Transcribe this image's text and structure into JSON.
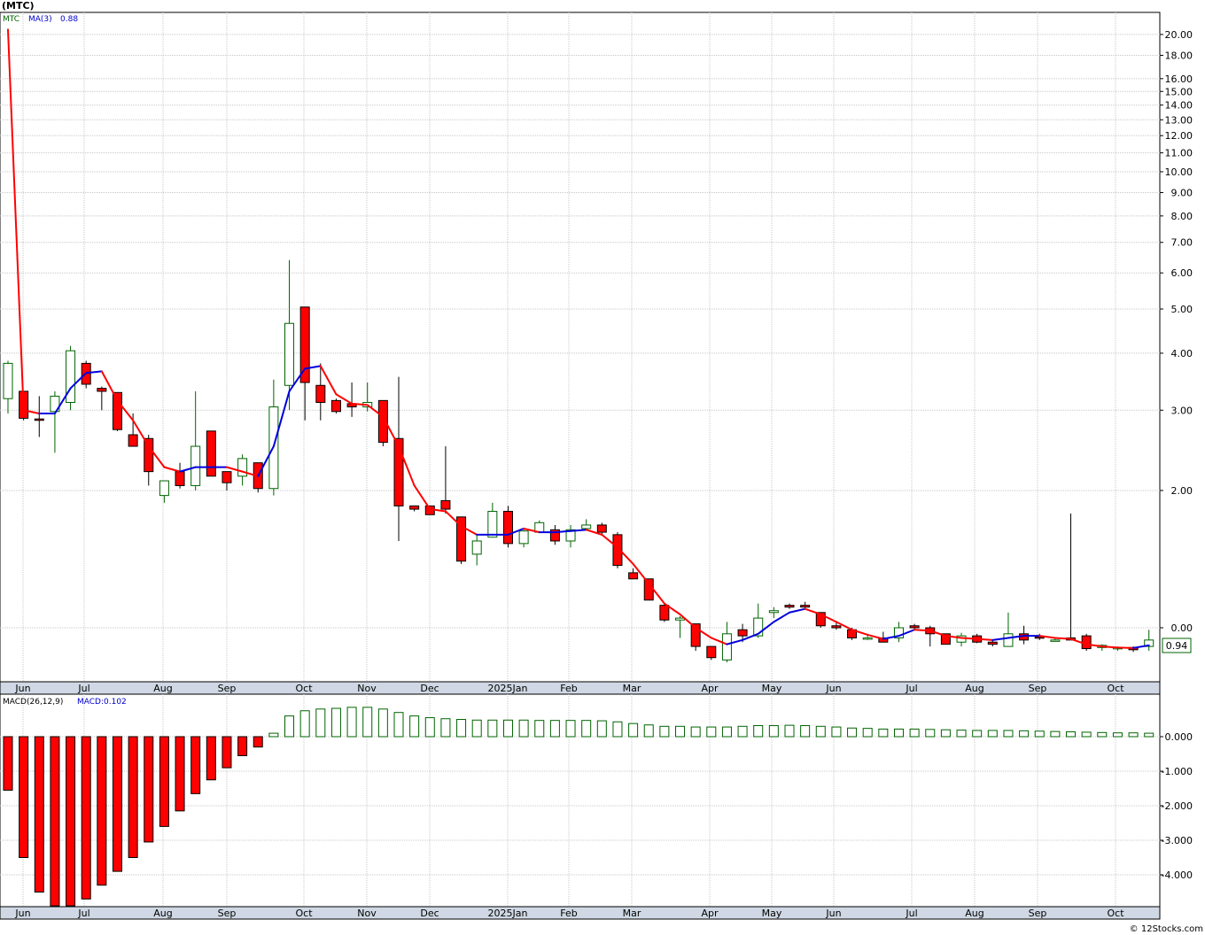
{
  "header": {
    "title": "(MTC)"
  },
  "price_legend": {
    "symbol": "MTC",
    "ma_label": "MA(3)",
    "ma_value": "0.88"
  },
  "macd_legend": {
    "label": "MACD(26,12,9)",
    "value_label": "MACD:0.102"
  },
  "last_price_label": "0.94",
  "footer": "© 12Stocks.com",
  "colors": {
    "up": "#006400",
    "down": "#ff0000",
    "ma_up": "#0000dd",
    "ma_down": "#ff0000",
    "grid": "#c8c8c8",
    "axis_band": "#cfd8e4"
  },
  "chart_data": [
    {
      "type": "candlestick",
      "scale": "log",
      "price_ticks": [
        20,
        18,
        16,
        15,
        14,
        13,
        12,
        11,
        10,
        9,
        8,
        7,
        6,
        5,
        4,
        3,
        2,
        0
      ],
      "price_tick_labels": [
        "20.00",
        "18.00",
        "16.00",
        "15.00",
        "14.00",
        "13.00",
        "12.00",
        "11.00",
        "10.00",
        "9.00",
        "8.00",
        "7.00",
        "6.00",
        "5.00",
        "4.00",
        "3.00",
        "2.00",
        "0.00"
      ],
      "months": [
        "Jun",
        "Jul",
        "Aug",
        "Sep",
        "Oct",
        "Nov",
        "Dec",
        "2025Jan",
        "Feb",
        "Mar",
        "Apr",
        "May",
        "Jun",
        "Jul",
        "Aug",
        "Sep",
        "Oct"
      ],
      "candles": [
        {
          "o": 3.18,
          "h": 3.85,
          "l": 2.95,
          "c": 3.8
        },
        {
          "o": 3.3,
          "h": 3.3,
          "l": 2.85,
          "c": 2.88
        },
        {
          "o": 2.87,
          "h": 3.22,
          "l": 2.62,
          "c": 2.85
        },
        {
          "o": 2.98,
          "h": 3.3,
          "l": 2.42,
          "c": 3.22
        },
        {
          "o": 3.12,
          "h": 4.15,
          "l": 3.0,
          "c": 4.05
        },
        {
          "o": 3.8,
          "h": 3.85,
          "l": 3.35,
          "c": 3.42
        },
        {
          "o": 3.35,
          "h": 3.38,
          "l": 3.0,
          "c": 3.3
        },
        {
          "o": 3.28,
          "h": 3.28,
          "l": 2.7,
          "c": 2.72
        },
        {
          "o": 2.65,
          "h": 2.95,
          "l": 2.5,
          "c": 2.5
        },
        {
          "o": 2.6,
          "h": 2.65,
          "l": 2.05,
          "c": 2.2
        },
        {
          "o": 1.95,
          "h": 2.1,
          "l": 1.88,
          "c": 2.1
        },
        {
          "o": 2.2,
          "h": 2.3,
          "l": 2.02,
          "c": 2.05
        },
        {
          "o": 2.05,
          "h": 3.3,
          "l": 2.0,
          "c": 2.5
        },
        {
          "o": 2.7,
          "h": 2.7,
          "l": 2.15,
          "c": 2.15
        },
        {
          "o": 2.2,
          "h": 2.2,
          "l": 2.0,
          "c": 2.08
        },
        {
          "o": 2.15,
          "h": 2.4,
          "l": 2.05,
          "c": 2.35
        },
        {
          "o": 2.3,
          "h": 2.3,
          "l": 1.98,
          "c": 2.02
        },
        {
          "o": 2.02,
          "h": 3.5,
          "l": 1.95,
          "c": 3.05
        },
        {
          "o": 3.4,
          "h": 6.4,
          "l": 3.0,
          "c": 4.65
        },
        {
          "o": 5.05,
          "h": 5.05,
          "l": 2.85,
          "c": 3.45
        },
        {
          "o": 3.4,
          "h": 3.8,
          "l": 2.85,
          "c": 3.12
        },
        {
          "o": 3.15,
          "h": 3.18,
          "l": 2.95,
          "c": 2.98
        },
        {
          "o": 3.1,
          "h": 3.45,
          "l": 2.9,
          "c": 3.05
        },
        {
          "o": 3.05,
          "h": 3.45,
          "l": 2.98,
          "c": 3.12
        },
        {
          "o": 3.15,
          "h": 3.15,
          "l": 2.5,
          "c": 2.55
        },
        {
          "o": 2.6,
          "h": 3.55,
          "l": 1.55,
          "c": 1.85
        },
        {
          "o": 1.85,
          "h": 1.85,
          "l": 1.8,
          "c": 1.82
        },
        {
          "o": 1.85,
          "h": 1.85,
          "l": 1.77,
          "c": 1.77
        },
        {
          "o": 1.9,
          "h": 2.5,
          "l": 1.78,
          "c": 1.82
        },
        {
          "o": 1.75,
          "h": 1.75,
          "l": 1.38,
          "c": 1.4
        },
        {
          "o": 1.45,
          "h": 1.6,
          "l": 1.37,
          "c": 1.55
        },
        {
          "o": 1.58,
          "h": 1.88,
          "l": 1.58,
          "c": 1.8
        },
        {
          "o": 1.8,
          "h": 1.85,
          "l": 1.5,
          "c": 1.53
        },
        {
          "o": 1.53,
          "h": 1.65,
          "l": 1.5,
          "c": 1.63
        },
        {
          "o": 1.62,
          "h": 1.72,
          "l": 1.62,
          "c": 1.7
        },
        {
          "o": 1.64,
          "h": 1.68,
          "l": 1.52,
          "c": 1.55
        },
        {
          "o": 1.55,
          "h": 1.68,
          "l": 1.5,
          "c": 1.64
        },
        {
          "o": 1.65,
          "h": 1.73,
          "l": 1.64,
          "c": 1.68
        },
        {
          "o": 1.68,
          "h": 1.7,
          "l": 1.6,
          "c": 1.62
        },
        {
          "o": 1.6,
          "h": 1.62,
          "l": 1.35,
          "c": 1.37
        },
        {
          "o": 1.32,
          "h": 1.35,
          "l": 1.28,
          "c": 1.28
        },
        {
          "o": 1.28,
          "h": 1.28,
          "l": 1.15,
          "c": 1.15
        },
        {
          "o": 1.12,
          "h": 1.13,
          "l": 1.03,
          "c": 1.04
        },
        {
          "o": 1.04,
          "h": 1.06,
          "l": 0.95,
          "c": 1.05
        },
        {
          "o": 1.02,
          "h": 1.02,
          "l": 0.89,
          "c": 0.91
        },
        {
          "o": 0.91,
          "h": 0.91,
          "l": 0.85,
          "c": 0.86
        },
        {
          "o": 0.85,
          "h": 1.03,
          "l": 0.84,
          "c": 0.97
        },
        {
          "o": 0.99,
          "h": 1.02,
          "l": 0.93,
          "c": 0.96
        },
        {
          "o": 0.96,
          "h": 1.13,
          "l": 0.95,
          "c": 1.05
        },
        {
          "o": 1.08,
          "h": 1.11,
          "l": 1.05,
          "c": 1.09
        },
        {
          "o": 1.12,
          "h": 1.13,
          "l": 1.1,
          "c": 1.11
        },
        {
          "o": 1.12,
          "h": 1.14,
          "l": 1.1,
          "c": 1.11
        },
        {
          "o": 1.08,
          "h": 1.08,
          "l": 1.0,
          "c": 1.01
        },
        {
          "o": 1.01,
          "h": 1.03,
          "l": 0.99,
          "c": 1.0
        },
        {
          "o": 0.99,
          "h": 1.0,
          "l": 0.94,
          "c": 0.95
        },
        {
          "o": 0.95,
          "h": 0.96,
          "l": 0.94,
          "c": 0.95
        },
        {
          "o": 0.95,
          "h": 0.98,
          "l": 0.93,
          "c": 0.93
        },
        {
          "o": 0.95,
          "h": 1.03,
          "l": 0.93,
          "c": 1.0
        },
        {
          "o": 1.01,
          "h": 1.02,
          "l": 0.99,
          "c": 1.0
        },
        {
          "o": 1.0,
          "h": 1.01,
          "l": 0.91,
          "c": 0.97
        },
        {
          "o": 0.97,
          "h": 0.97,
          "l": 0.92,
          "c": 0.92
        },
        {
          "o": 0.93,
          "h": 0.975,
          "l": 0.91,
          "c": 0.96
        },
        {
          "o": 0.96,
          "h": 0.97,
          "l": 0.925,
          "c": 0.93
        },
        {
          "o": 0.93,
          "h": 0.94,
          "l": 0.91,
          "c": 0.92
        },
        {
          "o": 0.91,
          "h": 1.08,
          "l": 0.91,
          "c": 0.97
        },
        {
          "o": 0.97,
          "h": 1.01,
          "l": 0.92,
          "c": 0.94
        },
        {
          "o": 0.955,
          "h": 0.97,
          "l": 0.94,
          "c": 0.95
        },
        {
          "o": 0.94,
          "h": 0.95,
          "l": 0.94,
          "c": 0.94
        },
        {
          "o": 0.95,
          "h": 1.78,
          "l": 0.94,
          "c": 0.94
        },
        {
          "o": 0.96,
          "h": 0.97,
          "l": 0.89,
          "c": 0.9
        },
        {
          "o": 0.905,
          "h": 0.92,
          "l": 0.89,
          "c": 0.915
        },
        {
          "o": 0.905,
          "h": 0.91,
          "l": 0.89,
          "c": 0.905
        },
        {
          "o": 0.905,
          "h": 0.91,
          "l": 0.885,
          "c": 0.895
        },
        {
          "o": 0.91,
          "h": 0.99,
          "l": 0.89,
          "c": 0.94
        }
      ],
      "ma3": [
        20.5,
        3.0,
        2.95,
        2.95,
        3.35,
        3.62,
        3.65,
        3.15,
        2.85,
        2.5,
        2.25,
        2.2,
        2.25,
        2.25,
        2.25,
        2.2,
        2.15,
        2.5,
        3.3,
        3.7,
        3.75,
        3.25,
        3.1,
        3.08,
        2.9,
        2.5,
        2.05,
        1.82,
        1.8,
        1.67,
        1.6,
        1.6,
        1.6,
        1.65,
        1.62,
        1.62,
        1.63,
        1.64,
        1.6,
        1.5,
        1.38,
        1.25,
        1.13,
        1.07,
        1.0,
        0.95,
        0.92,
        0.94,
        0.97,
        1.03,
        1.08,
        1.1,
        1.07,
        1.03,
        0.99,
        0.965,
        0.945,
        0.96,
        0.99,
        0.985,
        0.96,
        0.95,
        0.945,
        0.94,
        0.95,
        0.96,
        0.96,
        0.95,
        0.945,
        0.92,
        0.91,
        0.905,
        0.903,
        0.915
      ]
    },
    {
      "type": "bar",
      "name": "MACD",
      "ylim": [
        -4.9,
        1.0
      ],
      "ticks": [
        0,
        -1,
        -2,
        -3,
        -4
      ],
      "tick_labels": [
        "0.000",
        "-1.000",
        "-2.000",
        "-3.000",
        "-4.000"
      ],
      "values": [
        -1.55,
        -3.5,
        -4.5,
        -4.9,
        -4.9,
        -4.7,
        -4.3,
        -3.9,
        -3.5,
        -3.05,
        -2.6,
        -2.15,
        -1.65,
        -1.25,
        -0.9,
        -0.55,
        -0.3,
        0.1,
        0.6,
        0.75,
        0.8,
        0.82,
        0.85,
        0.85,
        0.8,
        0.7,
        0.6,
        0.55,
        0.52,
        0.5,
        0.48,
        0.48,
        0.48,
        0.48,
        0.47,
        0.47,
        0.47,
        0.47,
        0.46,
        0.43,
        0.38,
        0.34,
        0.3,
        0.3,
        0.28,
        0.28,
        0.28,
        0.3,
        0.32,
        0.32,
        0.33,
        0.32,
        0.3,
        0.28,
        0.25,
        0.24,
        0.22,
        0.22,
        0.22,
        0.21,
        0.2,
        0.19,
        0.18,
        0.18,
        0.18,
        0.17,
        0.16,
        0.15,
        0.14,
        0.13,
        0.12,
        0.11,
        0.11,
        0.1
      ]
    }
  ]
}
